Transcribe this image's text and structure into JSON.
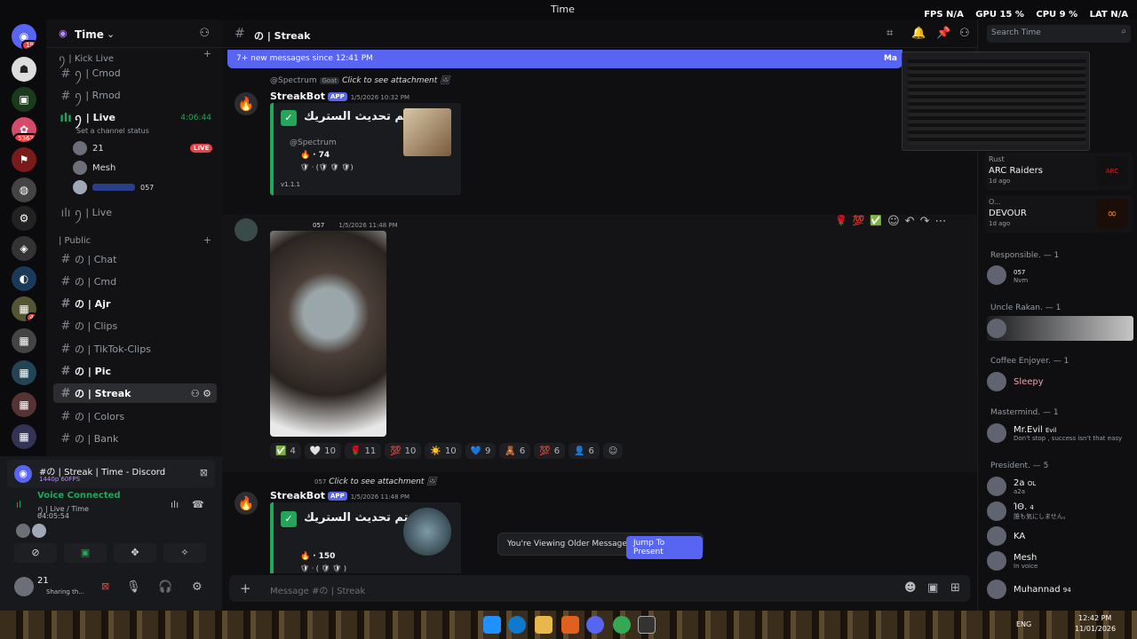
{
  "window": {
    "title": "Time"
  },
  "perf": {
    "fps_label": "FPS",
    "fps": "N/A",
    "gpu_label": "GPU",
    "gpu": "15 %",
    "cpu_label": "CPU",
    "cpu": "9 %",
    "lat_label": "LAT",
    "lat": "N/A"
  },
  "guilds": {
    "dm_badge": "19",
    "badge2": "5363",
    "badge3": "4"
  },
  "server": {
    "name": "Time"
  },
  "categories": {
    "kick": "ꪆ | Kick Live",
    "public": "| Public"
  },
  "channels": [
    {
      "name": "ꪆ | Cmod",
      "icon": "#"
    },
    {
      "name": "ꪆ | Rmod",
      "icon": "#"
    },
    {
      "name": "ꪆ | Live",
      "icon": "🔊",
      "time": "4:06:44",
      "status": "Set a channel status"
    },
    {
      "name": "ꪆ | Live",
      "icon": "🔊"
    },
    {
      "name": "の | Chat",
      "icon": "#"
    },
    {
      "name": "の | Cmd",
      "icon": "#"
    },
    {
      "name": "の | Ajr",
      "icon": "#"
    },
    {
      "name": "の | Clips",
      "icon": "#"
    },
    {
      "name": "の | TikTok-Clips",
      "icon": "#"
    },
    {
      "name": "の | Pic",
      "icon": "#"
    },
    {
      "name": "の | Streak",
      "icon": "#"
    },
    {
      "name": "の | Colors",
      "icon": "#"
    },
    {
      "name": "の | Bank",
      "icon": "#"
    }
  ],
  "voice_users": [
    {
      "name": "21",
      "live": "LIVE"
    },
    {
      "name": "Mesh"
    },
    {
      "name": "",
      "tag": "057"
    }
  ],
  "panel": {
    "stream_title": "#の | Streak | Time - Discord",
    "quality": "1440p 60FPS",
    "voice_status": "Voice Connected",
    "voice_channel": "ꪆ | Live / Time",
    "voice_time": "04:05:54",
    "user": "21",
    "user_status": "Sharing th..."
  },
  "header": {
    "channel": "の | Streak",
    "search_placeholder": "Search Time"
  },
  "newbar": {
    "text": "7+ new messages since 12:41 PM",
    "right": "Ma"
  },
  "messages": {
    "m1": {
      "reply_user": "@Spectrum",
      "reply_tag": "Goat",
      "reply_text": "Click to see attachment",
      "author": "StreakBot",
      "app": "APP",
      "time": "1/5/2026 10:32 PM",
      "embed_title": "تم تحديث الستريك •",
      "mention": "@Spectrum",
      "fire": "· 74",
      "shield": "· (🛡 🛡 🛡)",
      "version": "v1.1.1"
    },
    "m2": {
      "tag": "057",
      "time": "1/5/2026 11:48 PM"
    },
    "reactions": [
      {
        "e": "✅",
        "n": "4"
      },
      {
        "e": "🤍",
        "n": "10"
      },
      {
        "e": "🌹",
        "n": "11"
      },
      {
        "e": "💯",
        "n": "10"
      },
      {
        "e": "☀️",
        "n": "10"
      },
      {
        "e": "💙",
        "n": "9"
      },
      {
        "e": "🧸",
        "n": "6"
      },
      {
        "e": "💯",
        "n": "6"
      },
      {
        "e": "👤",
        "n": "6"
      }
    ],
    "m3": {
      "reply_tag": "057",
      "reply_text": "Click to see attachment",
      "author": "StreakBot",
      "app": "APP",
      "time": "1/5/2026 11:48 PM",
      "embed_title": "تم تحديث الستريك •",
      "fire": "· 150",
      "shield": "· ( 🛡 🛡 )"
    }
  },
  "older": {
    "text": "You're Viewing Older Messages",
    "button": "Jump To Present"
  },
  "composer": {
    "placeholder": "Message #の | Streak"
  },
  "activities": [
    {
      "top": "Rust",
      "name": "ARC Raiders",
      "sub": "1d ago"
    },
    {
      "top": "O...",
      "name": "DEVOUR",
      "sub": "1d ago"
    }
  ],
  "member_groups": [
    {
      "cat": "Responsible. — 1",
      "members": [
        {
          "name": "",
          "tag": "057",
          "sub": "Nvm"
        }
      ]
    },
    {
      "cat": "Uncle Rakan. — 1",
      "members": [
        {
          "name": "",
          "sub": ""
        }
      ]
    },
    {
      "cat": "Coffee Enjoyer. — 1",
      "members": [
        {
          "name": "Sleepy",
          "sub": ""
        }
      ]
    },
    {
      "cat": "Mastermind. — 1",
      "members": [
        {
          "name": "Mr.Evil",
          "tag": "Evil",
          "sub": "Don't stop , success isn't that easy"
        }
      ]
    },
    {
      "cat": "President. — 5",
      "members": [
        {
          "name": "2a",
          "tag": "OL",
          "sub": "a2a"
        },
        {
          "name": "ΊΘ.",
          "tag": "4",
          "sub": "誰も気にしません。"
        },
        {
          "name": "KA",
          "sub": ""
        },
        {
          "name": "Mesh",
          "sub": "In voice"
        },
        {
          "name": "Muhannad",
          "tag": "94",
          "sub": ""
        }
      ]
    }
  ],
  "taskbar": {
    "lang": "ENG",
    "time": "12:42 PM",
    "date": "11/01/2026"
  },
  "colors": {
    "accent": "#5865f2",
    "green": "#23a55a",
    "red": "#f23f43"
  }
}
